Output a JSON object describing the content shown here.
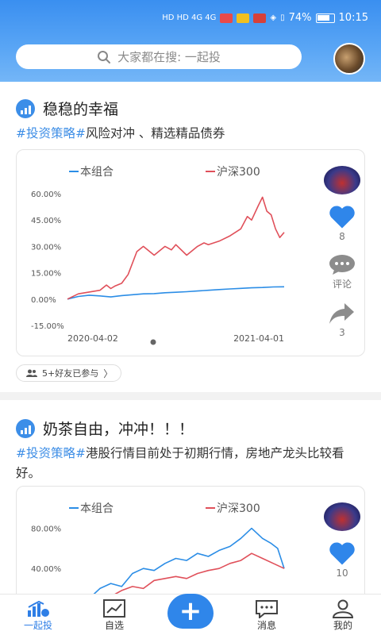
{
  "status": {
    "left_icons": "HD HD 4G 4G",
    "battery": "74%",
    "time": "10:15"
  },
  "search": {
    "placeholder": "大家都在搜: 一起投"
  },
  "posts": [
    {
      "title": "稳稳的幸福",
      "tag": "#投资策略#",
      "desc": "风险对冲 、精选精品债券",
      "likes": "8",
      "comment_label": "评论",
      "shares": "3",
      "friends": "5+好友已参与"
    },
    {
      "title": "奶茶自由，冲冲！！！",
      "tag": "#投资策略#",
      "desc": "港股行情目前处于初期行情，房地产龙头比较看好。",
      "likes": "10"
    }
  ],
  "chart_data": [
    {
      "type": "line",
      "series": [
        {
          "name": "本组合",
          "color": "#2b8de6",
          "points": [
            [
              0,
              0
            ],
            [
              5,
              1.5
            ],
            [
              10,
              2.2
            ],
            [
              15,
              1.8
            ],
            [
              20,
              1.2
            ],
            [
              25,
              2
            ],
            [
              30,
              2.5
            ],
            [
              35,
              3
            ],
            [
              40,
              3.1
            ],
            [
              45,
              3.6
            ],
            [
              50,
              3.9
            ],
            [
              55,
              4.2
            ],
            [
              60,
              4.6
            ],
            [
              65,
              5
            ],
            [
              70,
              5.4
            ],
            [
              75,
              5.8
            ],
            [
              80,
              6.1
            ],
            [
              85,
              6.4
            ],
            [
              90,
              6.6
            ],
            [
              95,
              6.9
            ],
            [
              100,
              7
            ]
          ]
        },
        {
          "name": "沪深300",
          "color": "#e0505a",
          "points": [
            [
              0,
              0
            ],
            [
              5,
              3
            ],
            [
              10,
              4
            ],
            [
              15,
              5
            ],
            [
              18,
              8
            ],
            [
              20,
              6
            ],
            [
              22,
              7.5
            ],
            [
              25,
              9
            ],
            [
              28,
              14
            ],
            [
              32,
              27
            ],
            [
              35,
              30
            ],
            [
              40,
              25
            ],
            [
              45,
              30
            ],
            [
              48,
              28
            ],
            [
              50,
              31
            ],
            [
              55,
              25
            ],
            [
              60,
              30
            ],
            [
              63,
              32
            ],
            [
              65,
              31
            ],
            [
              70,
              33
            ],
            [
              75,
              36
            ],
            [
              80,
              40
            ],
            [
              83,
              47
            ],
            [
              85,
              45
            ],
            [
              88,
              53
            ],
            [
              90,
              58
            ],
            [
              92,
              50
            ],
            [
              94,
              48
            ],
            [
              96,
              40
            ],
            [
              98,
              35
            ],
            [
              100,
              38
            ]
          ]
        }
      ],
      "x_labels": [
        "2020-04-02",
        "2021-04-01"
      ],
      "y_ticks": [
        "60.00%",
        "45.00%",
        "30.00%",
        "15.00%",
        "0.00%",
        "-15.00%"
      ],
      "y_values": [
        60,
        45,
        30,
        15,
        0,
        -15
      ],
      "ylim": [
        -15,
        60
      ]
    },
    {
      "type": "line",
      "series": [
        {
          "name": "本组合",
          "color": "#2b8de6",
          "points": [
            [
              0,
              0
            ],
            [
              5,
              3
            ],
            [
              10,
              10
            ],
            [
              15,
              20
            ],
            [
              20,
              25
            ],
            [
              25,
              22
            ],
            [
              30,
              35
            ],
            [
              35,
              40
            ],
            [
              40,
              38
            ],
            [
              45,
              45
            ],
            [
              50,
              50
            ],
            [
              55,
              48
            ],
            [
              60,
              55
            ],
            [
              65,
              52
            ],
            [
              70,
              58
            ],
            [
              75,
              62
            ],
            [
              80,
              70
            ],
            [
              85,
              80
            ],
            [
              88,
              74
            ],
            [
              90,
              70
            ],
            [
              94,
              65
            ],
            [
              97,
              60
            ],
            [
              100,
              40
            ]
          ]
        },
        {
          "name": "沪深300",
          "color": "#e0505a",
          "points": [
            [
              0,
              0
            ],
            [
              5,
              2
            ],
            [
              10,
              5
            ],
            [
              15,
              10
            ],
            [
              20,
              12
            ],
            [
              25,
              18
            ],
            [
              30,
              22
            ],
            [
              35,
              20
            ],
            [
              40,
              28
            ],
            [
              45,
              30
            ],
            [
              50,
              32
            ],
            [
              55,
              30
            ],
            [
              60,
              35
            ],
            [
              65,
              38
            ],
            [
              70,
              40
            ],
            [
              75,
              45
            ],
            [
              80,
              48
            ],
            [
              85,
              55
            ],
            [
              90,
              50
            ],
            [
              95,
              45
            ],
            [
              100,
              40
            ]
          ]
        }
      ],
      "y_ticks": [
        "80.00%",
        "40.00%"
      ],
      "y_values": [
        80,
        40
      ],
      "ylim": [
        -5,
        90
      ]
    }
  ],
  "tabs": [
    {
      "label": "一起投",
      "icon": "bar-chart-icon",
      "active": true
    },
    {
      "label": "自选",
      "icon": "trend-icon"
    },
    {
      "label": "消息",
      "icon": "message-icon"
    },
    {
      "label": "我的",
      "icon": "user-icon"
    }
  ],
  "fab": {
    "label": "+"
  }
}
